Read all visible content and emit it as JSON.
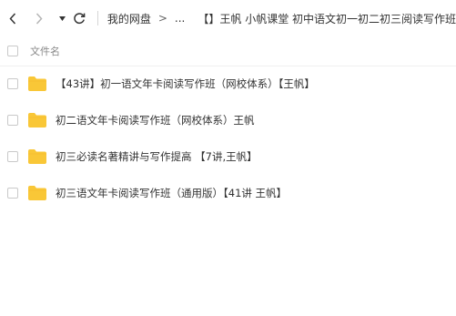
{
  "toolbar": {
    "back_icon": "chevron-left-icon",
    "forward_icon": "chevron-right-icon",
    "dropdown_icon": "caret-down-icon",
    "refresh_icon": "refresh-icon"
  },
  "breadcrumb": {
    "root": "我的网盘",
    "separator": ">",
    "ellipsis": "...",
    "current": "【】王帆 小帆课堂 初中语文初一初二初三阅读写作班"
  },
  "list": {
    "column_name": "文件名",
    "items": [
      {
        "name": "【43讲】初一语文年卡阅读写作班（网校体系）【王帆】",
        "icon": "folder-icon"
      },
      {
        "name": "初二语文年卡阅读写作班（网校体系）王帆",
        "icon": "folder-icon"
      },
      {
        "name": "初三必读名著精讲与写作提高 【7讲,王帆】",
        "icon": "folder-icon"
      },
      {
        "name": "初三语文年卡阅读写作班（通用版）【41讲 王帆】",
        "icon": "folder-icon"
      }
    ]
  },
  "colors": {
    "folder": "#f9c737",
    "text": "#333333",
    "muted": "#888888"
  }
}
